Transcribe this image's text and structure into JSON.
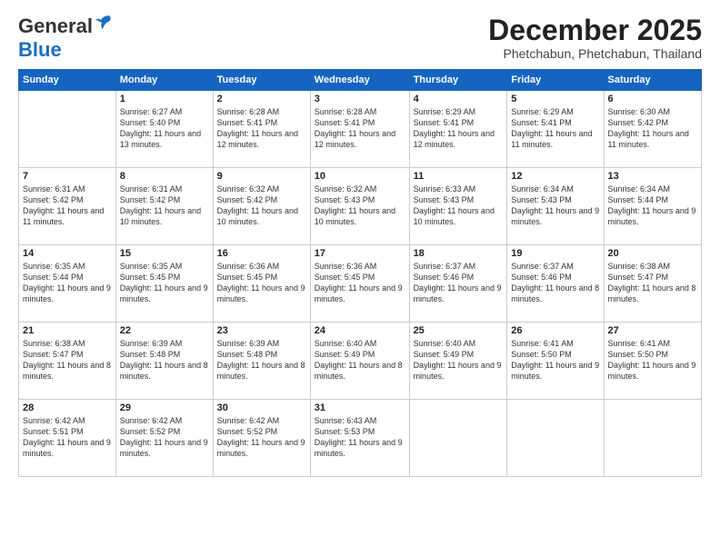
{
  "header": {
    "logo_general": "General",
    "logo_blue": "Blue",
    "month_title": "December 2025",
    "subtitle": "Phetchabun, Phetchabun, Thailand"
  },
  "weekdays": [
    "Sunday",
    "Monday",
    "Tuesday",
    "Wednesday",
    "Thursday",
    "Friday",
    "Saturday"
  ],
  "weeks": [
    [
      {
        "date": "",
        "sunrise": "",
        "sunset": "",
        "daylight": ""
      },
      {
        "date": "1",
        "sunrise": "Sunrise: 6:27 AM",
        "sunset": "Sunset: 5:40 PM",
        "daylight": "Daylight: 11 hours and 13 minutes."
      },
      {
        "date": "2",
        "sunrise": "Sunrise: 6:28 AM",
        "sunset": "Sunset: 5:41 PM",
        "daylight": "Daylight: 11 hours and 12 minutes."
      },
      {
        "date": "3",
        "sunrise": "Sunrise: 6:28 AM",
        "sunset": "Sunset: 5:41 PM",
        "daylight": "Daylight: 11 hours and 12 minutes."
      },
      {
        "date": "4",
        "sunrise": "Sunrise: 6:29 AM",
        "sunset": "Sunset: 5:41 PM",
        "daylight": "Daylight: 11 hours and 12 minutes."
      },
      {
        "date": "5",
        "sunrise": "Sunrise: 6:29 AM",
        "sunset": "Sunset: 5:41 PM",
        "daylight": "Daylight: 11 hours and 11 minutes."
      },
      {
        "date": "6",
        "sunrise": "Sunrise: 6:30 AM",
        "sunset": "Sunset: 5:42 PM",
        "daylight": "Daylight: 11 hours and 11 minutes."
      }
    ],
    [
      {
        "date": "7",
        "sunrise": "Sunrise: 6:31 AM",
        "sunset": "Sunset: 5:42 PM",
        "daylight": "Daylight: 11 hours and 11 minutes."
      },
      {
        "date": "8",
        "sunrise": "Sunrise: 6:31 AM",
        "sunset": "Sunset: 5:42 PM",
        "daylight": "Daylight: 11 hours and 10 minutes."
      },
      {
        "date": "9",
        "sunrise": "Sunrise: 6:32 AM",
        "sunset": "Sunset: 5:42 PM",
        "daylight": "Daylight: 11 hours and 10 minutes."
      },
      {
        "date": "10",
        "sunrise": "Sunrise: 6:32 AM",
        "sunset": "Sunset: 5:43 PM",
        "daylight": "Daylight: 11 hours and 10 minutes."
      },
      {
        "date": "11",
        "sunrise": "Sunrise: 6:33 AM",
        "sunset": "Sunset: 5:43 PM",
        "daylight": "Daylight: 11 hours and 10 minutes."
      },
      {
        "date": "12",
        "sunrise": "Sunrise: 6:34 AM",
        "sunset": "Sunset: 5:43 PM",
        "daylight": "Daylight: 11 hours and 9 minutes."
      },
      {
        "date": "13",
        "sunrise": "Sunrise: 6:34 AM",
        "sunset": "Sunset: 5:44 PM",
        "daylight": "Daylight: 11 hours and 9 minutes."
      }
    ],
    [
      {
        "date": "14",
        "sunrise": "Sunrise: 6:35 AM",
        "sunset": "Sunset: 5:44 PM",
        "daylight": "Daylight: 11 hours and 9 minutes."
      },
      {
        "date": "15",
        "sunrise": "Sunrise: 6:35 AM",
        "sunset": "Sunset: 5:45 PM",
        "daylight": "Daylight: 11 hours and 9 minutes."
      },
      {
        "date": "16",
        "sunrise": "Sunrise: 6:36 AM",
        "sunset": "Sunset: 5:45 PM",
        "daylight": "Daylight: 11 hours and 9 minutes."
      },
      {
        "date": "17",
        "sunrise": "Sunrise: 6:36 AM",
        "sunset": "Sunset: 5:45 PM",
        "daylight": "Daylight: 11 hours and 9 minutes."
      },
      {
        "date": "18",
        "sunrise": "Sunrise: 6:37 AM",
        "sunset": "Sunset: 5:46 PM",
        "daylight": "Daylight: 11 hours and 9 minutes."
      },
      {
        "date": "19",
        "sunrise": "Sunrise: 6:37 AM",
        "sunset": "Sunset: 5:46 PM",
        "daylight": "Daylight: 11 hours and 8 minutes."
      },
      {
        "date": "20",
        "sunrise": "Sunrise: 6:38 AM",
        "sunset": "Sunset: 5:47 PM",
        "daylight": "Daylight: 11 hours and 8 minutes."
      }
    ],
    [
      {
        "date": "21",
        "sunrise": "Sunrise: 6:38 AM",
        "sunset": "Sunset: 5:47 PM",
        "daylight": "Daylight: 11 hours and 8 minutes."
      },
      {
        "date": "22",
        "sunrise": "Sunrise: 6:39 AM",
        "sunset": "Sunset: 5:48 PM",
        "daylight": "Daylight: 11 hours and 8 minutes."
      },
      {
        "date": "23",
        "sunrise": "Sunrise: 6:39 AM",
        "sunset": "Sunset: 5:48 PM",
        "daylight": "Daylight: 11 hours and 8 minutes."
      },
      {
        "date": "24",
        "sunrise": "Sunrise: 6:40 AM",
        "sunset": "Sunset: 5:49 PM",
        "daylight": "Daylight: 11 hours and 8 minutes."
      },
      {
        "date": "25",
        "sunrise": "Sunrise: 6:40 AM",
        "sunset": "Sunset: 5:49 PM",
        "daylight": "Daylight: 11 hours and 9 minutes."
      },
      {
        "date": "26",
        "sunrise": "Sunrise: 6:41 AM",
        "sunset": "Sunset: 5:50 PM",
        "daylight": "Daylight: 11 hours and 9 minutes."
      },
      {
        "date": "27",
        "sunrise": "Sunrise: 6:41 AM",
        "sunset": "Sunset: 5:50 PM",
        "daylight": "Daylight: 11 hours and 9 minutes."
      }
    ],
    [
      {
        "date": "28",
        "sunrise": "Sunrise: 6:42 AM",
        "sunset": "Sunset: 5:51 PM",
        "daylight": "Daylight: 11 hours and 9 minutes."
      },
      {
        "date": "29",
        "sunrise": "Sunrise: 6:42 AM",
        "sunset": "Sunset: 5:52 PM",
        "daylight": "Daylight: 11 hours and 9 minutes."
      },
      {
        "date": "30",
        "sunrise": "Sunrise: 6:42 AM",
        "sunset": "Sunset: 5:52 PM",
        "daylight": "Daylight: 11 hours and 9 minutes."
      },
      {
        "date": "31",
        "sunrise": "Sunrise: 6:43 AM",
        "sunset": "Sunset: 5:53 PM",
        "daylight": "Daylight: 11 hours and 9 minutes."
      },
      {
        "date": "",
        "sunrise": "",
        "sunset": "",
        "daylight": ""
      },
      {
        "date": "",
        "sunrise": "",
        "sunset": "",
        "daylight": ""
      },
      {
        "date": "",
        "sunrise": "",
        "sunset": "",
        "daylight": ""
      }
    ]
  ]
}
